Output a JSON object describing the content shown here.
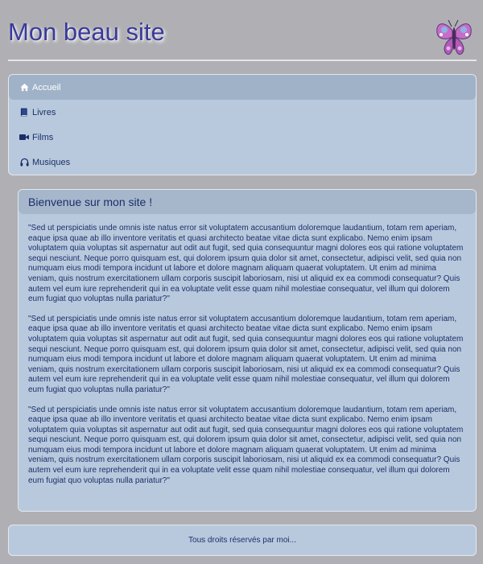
{
  "header": {
    "site_title": "Mon beau site",
    "logo_icon": "butterfly-icon"
  },
  "nav": {
    "items": [
      {
        "label": "Accueil",
        "icon": "home-icon",
        "active": true
      },
      {
        "label": "Livres",
        "icon": "book-icon",
        "active": false
      },
      {
        "label": "Films",
        "icon": "video-camera-icon",
        "active": false
      },
      {
        "label": "Musiques",
        "icon": "headphones-icon",
        "active": false
      }
    ]
  },
  "main": {
    "title": "Bienvenue sur mon site !",
    "paragraphs": [
      "\"Sed ut perspiciatis unde omnis iste natus error sit voluptatem accusantium doloremque laudantium, totam rem aperiam, eaque ipsa quae ab illo inventore veritatis et quasi architecto beatae vitae dicta sunt explicabo. Nemo enim ipsam voluptatem quia voluptas sit aspernatur aut odit aut fugit, sed quia consequuntur magni dolores eos qui ratione voluptatem sequi nesciunt. Neque porro quisquam est, qui dolorem ipsum quia dolor sit amet, consectetur, adipisci velit, sed quia non numquam eius modi tempora incidunt ut labore et dolore magnam aliquam quaerat voluptatem. Ut enim ad minima veniam, quis nostrum exercitationem ullam corporis suscipit laboriosam, nisi ut aliquid ex ea commodi consequatur? Quis autem vel eum iure reprehenderit qui in ea voluptate velit esse quam nihil molestiae consequatur, vel illum qui dolorem eum fugiat quo voluptas nulla pariatur?\"",
      "\"Sed ut perspiciatis unde omnis iste natus error sit voluptatem accusantium doloremque laudantium, totam rem aperiam, eaque ipsa quae ab illo inventore veritatis et quasi architecto beatae vitae dicta sunt explicabo. Nemo enim ipsam voluptatem quia voluptas sit aspernatur aut odit aut fugit, sed quia consequuntur magni dolores eos qui ratione voluptatem sequi nesciunt. Neque porro quisquam est, qui dolorem ipsum quia dolor sit amet, consectetur, adipisci velit, sed quia non numquam eius modi tempora incidunt ut labore et dolore magnam aliquam quaerat voluptatem. Ut enim ad minima veniam, quis nostrum exercitationem ullam corporis suscipit laboriosam, nisi ut aliquid ex ea commodi consequatur? Quis autem vel eum iure reprehenderit qui in ea voluptate velit esse quam nihil molestiae consequatur, vel illum qui dolorem eum fugiat quo voluptas nulla pariatur?\"",
      "\"Sed ut perspiciatis unde omnis iste natus error sit voluptatem accusantium doloremque laudantium, totam rem aperiam, eaque ipsa quae ab illo inventore veritatis et quasi architecto beatae vitae dicta sunt explicabo. Nemo enim ipsam voluptatem quia voluptas sit aspernatur aut odit aut fugit, sed quia consequuntur magni dolores eos qui ratione voluptatem sequi nesciunt. Neque porro quisquam est, qui dolorem ipsum quia dolor sit amet, consectetur, adipisci velit, sed quia non numquam eius modi tempora incidunt ut labore et dolore magnam aliquam quaerat voluptatem. Ut enim ad minima veniam, quis nostrum exercitationem ullam corporis suscipit laboriosam, nisi ut aliquid ex ea commodi consequatur? Quis autem vel eum iure reprehenderit qui in ea voluptate velit esse quam nihil molestiae consequatur, vel illum qui dolorem eum fugiat quo voluptas nulla pariatur?\""
    ]
  },
  "footer": {
    "text": "Tous droits réservés par moi..."
  },
  "colors": {
    "page_background": "#b0b0b4",
    "panel_background": "#b9c9dd",
    "active_background": "#a0b2c8",
    "title_color": "#3a3a9a",
    "text_color": "#1a2f6a"
  }
}
